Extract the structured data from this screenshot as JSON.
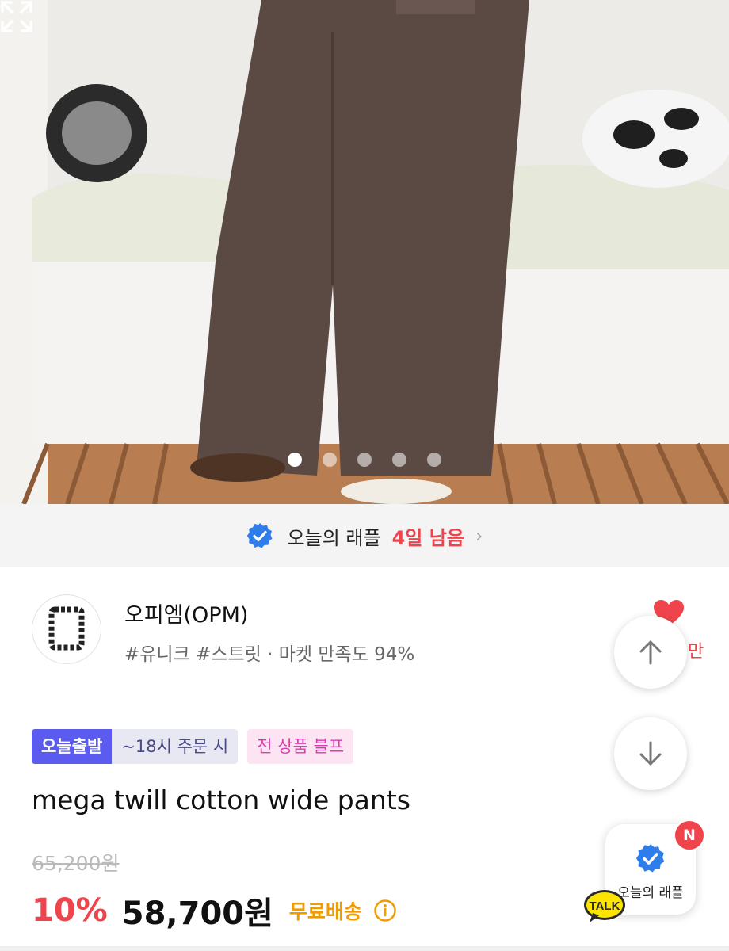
{
  "gallery": {
    "total_images": 5,
    "active_index": 0,
    "expand_icon": "expand-icon"
  },
  "raffle_banner": {
    "label": "오늘의 래플",
    "remaining": "4일 남음",
    "icon": "verified-check-icon"
  },
  "shop": {
    "name": "오피엠(OPM)",
    "tags": "#유니크 #스트릿 · 마켓 만족도 94%",
    "like_peek": "만"
  },
  "product": {
    "badges": {
      "delivery": "오늘출발",
      "delivery_note": "~18시 주문 시",
      "promo": "전 상품 블프"
    },
    "name": "mega twill cotton wide pants",
    "original_price": "65,200원",
    "discount": "10%",
    "price": "58,700원",
    "shipping": "무료배송"
  },
  "floating": {
    "raffle_label": "오늘의 래플",
    "new_badge": "N",
    "talk_label": "TALK"
  },
  "colors": {
    "accent_red": "#f0444c",
    "brand_blue": "#2f7dea",
    "badge_purple": "#5b5bf0",
    "shipping_orange": "#f09b00"
  }
}
